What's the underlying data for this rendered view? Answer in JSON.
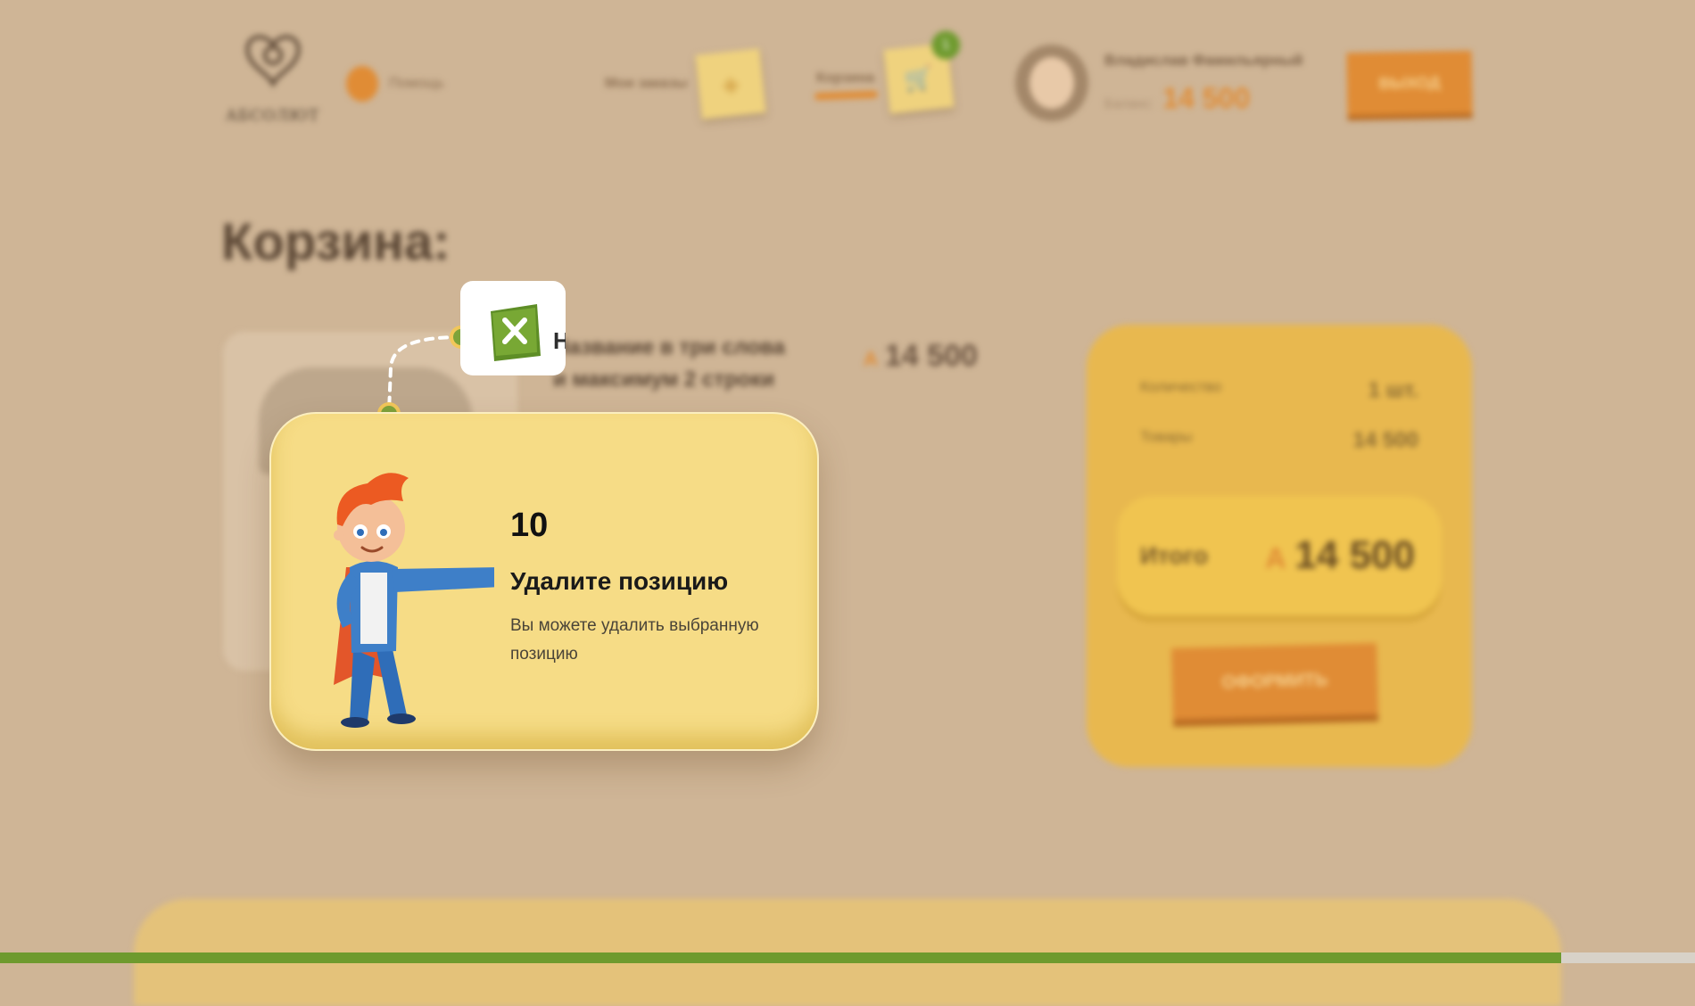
{
  "header": {
    "logo_text": "АБСОЛЮТ",
    "help_label": "Помощь",
    "orders_label": "Мои заказы",
    "cart_label": "Корзина",
    "cart_count": "1",
    "user_name": "Владислав Фамильярный",
    "balance_label": "Баланс:",
    "balance_value": "14 500",
    "logout_label": "ВЫХОД"
  },
  "page": {
    "title": "Корзина:"
  },
  "product": {
    "name": "Название в три слова и максимум 2 строки",
    "price": "14 500",
    "currency_symbol": "А"
  },
  "summary": {
    "quantity_label": "Количество",
    "quantity_value": "1 шт.",
    "goods_label": "Товары",
    "goods_value": "14 500",
    "total_label": "Итого",
    "total_value": "14 500",
    "checkout_label": "ОФОРМИТЬ"
  },
  "tooltip": {
    "step": "10",
    "title": "Удалите позицию",
    "description": "Вы можете удалить выбранную позицию",
    "focus_peek": "Н"
  },
  "icons": {
    "delete": "close-icon",
    "help": "coin-icon",
    "orders": "box-icon",
    "cart": "cart-icon"
  },
  "colors": {
    "accent_orange": "#e08c35",
    "accent_green": "#6e9a2e",
    "card_yellow": "#f6dc86",
    "backdrop": "#cfb596"
  }
}
